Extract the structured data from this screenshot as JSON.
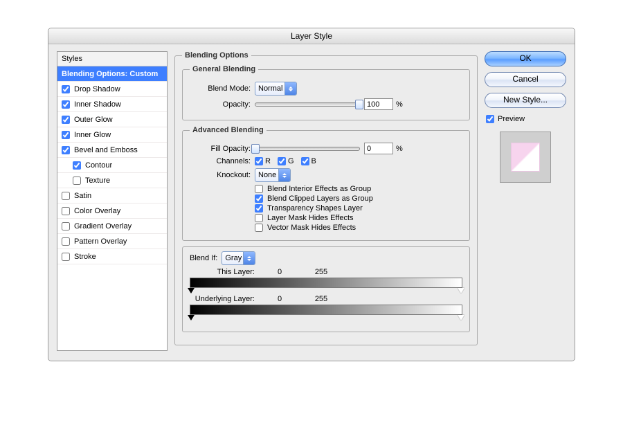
{
  "dialog": {
    "title": "Layer Style"
  },
  "sidebar": {
    "header": "Styles",
    "items": [
      {
        "label": "Blending Options: Custom",
        "checked": null,
        "selected": true,
        "indent": false
      },
      {
        "label": "Drop Shadow",
        "checked": true,
        "selected": false,
        "indent": false
      },
      {
        "label": "Inner Shadow",
        "checked": true,
        "selected": false,
        "indent": false
      },
      {
        "label": "Outer Glow",
        "checked": true,
        "selected": false,
        "indent": false
      },
      {
        "label": "Inner Glow",
        "checked": true,
        "selected": false,
        "indent": false
      },
      {
        "label": "Bevel and Emboss",
        "checked": true,
        "selected": false,
        "indent": false
      },
      {
        "label": "Contour",
        "checked": true,
        "selected": false,
        "indent": true
      },
      {
        "label": "Texture",
        "checked": false,
        "selected": false,
        "indent": true
      },
      {
        "label": "Satin",
        "checked": false,
        "selected": false,
        "indent": false
      },
      {
        "label": "Color Overlay",
        "checked": false,
        "selected": false,
        "indent": false
      },
      {
        "label": "Gradient Overlay",
        "checked": false,
        "selected": false,
        "indent": false
      },
      {
        "label": "Pattern Overlay",
        "checked": false,
        "selected": false,
        "indent": false
      },
      {
        "label": "Stroke",
        "checked": false,
        "selected": false,
        "indent": false
      }
    ]
  },
  "blending": {
    "legend": "Blending Options",
    "general": {
      "legend": "General Blending",
      "blend_mode_label": "Blend Mode:",
      "blend_mode_value": "Normal",
      "opacity_label": "Opacity:",
      "opacity_value": "100",
      "opacity_pct": 100,
      "percent": "%"
    },
    "advanced": {
      "legend": "Advanced Blending",
      "fill_opacity_label": "Fill Opacity:",
      "fill_opacity_value": "0",
      "fill_opacity_pct": 0,
      "channels_label": "Channels:",
      "channels": {
        "R": true,
        "G": true,
        "B": true
      },
      "channel_names": {
        "r": "R",
        "g": "G",
        "b": "B"
      },
      "knockout_label": "Knockout:",
      "knockout_value": "None",
      "opts": {
        "interior": {
          "label": "Blend Interior Effects as Group",
          "checked": false
        },
        "clipped": {
          "label": "Blend Clipped Layers as Group",
          "checked": true
        },
        "transparency": {
          "label": "Transparency Shapes Layer",
          "checked": true
        },
        "layer_mask": {
          "label": "Layer Mask Hides Effects",
          "checked": false
        },
        "vector_mask": {
          "label": "Vector Mask Hides Effects",
          "checked": false
        }
      }
    },
    "blend_if": {
      "label": "Blend If:",
      "channel": "Gray",
      "this_layer_label": "This Layer:",
      "this_layer": {
        "lo": "0",
        "hi": "255"
      },
      "underlying_label": "Underlying Layer:",
      "underlying": {
        "lo": "0",
        "hi": "255"
      }
    }
  },
  "buttons": {
    "ok": "OK",
    "cancel": "Cancel",
    "new_style": "New Style..."
  },
  "preview": {
    "label": "Preview",
    "checked": true
  }
}
